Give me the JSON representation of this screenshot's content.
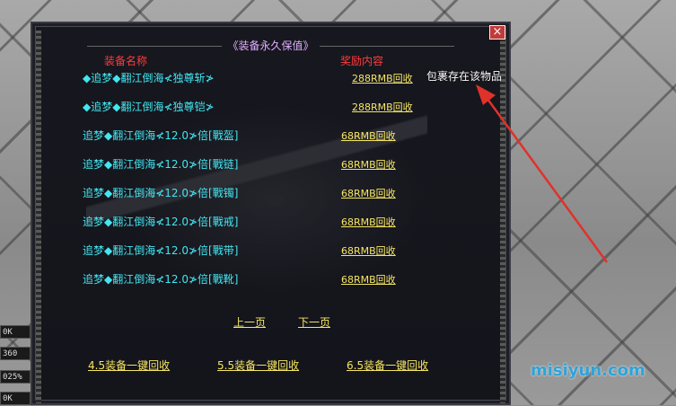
{
  "dialog": {
    "title": "《装备永久保值》",
    "close_label": "×",
    "col_name_header": "装备名称",
    "col_reward_header": "奖励内容",
    "items": [
      {
        "name": "◆追梦◆翻江倒海≮独尊斩≯",
        "reward": "288RMB回收"
      },
      {
        "name": "◆追梦◆翻江倒海≮独尊铠≯",
        "reward": "288RMB回收"
      },
      {
        "name": "追梦◆翻江倒海≮12.0≯倍[戰盔]",
        "reward": "68RMB回收"
      },
      {
        "name": "追梦◆翻江倒海≮12.0≯倍[戰链]",
        "reward": "68RMB回收"
      },
      {
        "name": "追梦◆翻江倒海≮12.0≯倍[戰镯]",
        "reward": "68RMB回收"
      },
      {
        "name": "追梦◆翻江倒海≮12.0≯倍[戰戒]",
        "reward": "68RMB回收"
      },
      {
        "name": "追梦◆翻江倒海≮12.0≯倍[戰带]",
        "reward": "68RMB回收"
      },
      {
        "name": "追梦◆翻江倒海≮12.0≯倍[戰靴]",
        "reward": "68RMB回收"
      }
    ],
    "prev_page": "上一页",
    "next_page": "下一页",
    "bulk_recycle": [
      "4.5装备一键回收",
      "5.5装备一键回收",
      "6.5装备一键回收"
    ]
  },
  "annotation": {
    "note": "包裹存在该物品",
    "arrow_color": "#e0322a"
  },
  "hud": [
    "0K",
    "360",
    "025%",
    "0K"
  ],
  "watermark": "misiyun.com"
}
